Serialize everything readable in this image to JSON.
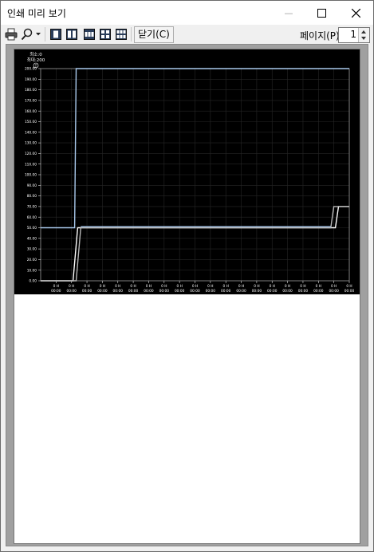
{
  "window": {
    "title": "인쇄 미리 보기",
    "min_glyph": "—",
    "max_glyph": "☐",
    "close_glyph": "✕"
  },
  "toolbar": {
    "close_label": "닫기(C)",
    "page_label": "페이지(P)",
    "page_value": "1"
  },
  "chart_data": {
    "type": "line",
    "header_min": "최소:0",
    "header_max": "최대:200",
    "unit_marker": "T",
    "ylim": [
      0,
      200
    ],
    "y_ticks": [
      "0.00",
      "10.00",
      "20.00",
      "30.00",
      "40.00",
      "50.00",
      "60.00",
      "70.00",
      "80.00",
      "90.00",
      "100.00",
      "110.00",
      "120.00",
      "130.00",
      "140.00",
      "150.00",
      "160.00",
      "170.00",
      "180.00",
      "190.00",
      "200.00"
    ],
    "x_ticks": [
      [
        "0 H",
        "00:00"
      ],
      [
        "0 H",
        "00:00"
      ],
      [
        "0 H",
        "00:00"
      ],
      [
        "0 H",
        "00:00"
      ],
      [
        "0 H",
        "00:00"
      ],
      [
        "0 H",
        "00:00"
      ],
      [
        "0 H",
        "00:00"
      ],
      [
        "0 H",
        "00:00"
      ],
      [
        "0 H",
        "00:00"
      ],
      [
        "0 H",
        "00:00"
      ],
      [
        "0 H",
        "00:00"
      ],
      [
        "0 H",
        "00:00"
      ],
      [
        "0 H",
        "00:00"
      ],
      [
        "0 H",
        "00:00"
      ],
      [
        "0 H",
        "00:00"
      ],
      [
        "0 H",
        "00:00"
      ],
      [
        "0 H",
        "00:00"
      ],
      [
        "0 H",
        "00:00"
      ],
      [
        "0 H",
        "00:00"
      ],
      [
        "0 H",
        "00:00"
      ]
    ],
    "grid": true,
    "series": [
      {
        "color": "#a9c9ec",
        "x": [
          0,
          0.11,
          0.115,
          1
        ],
        "y": [
          50,
          50,
          200,
          200
        ]
      },
      {
        "color": "#ffffff",
        "x": [
          0,
          0.105,
          0.12,
          0.955,
          0.965,
          1
        ],
        "y": [
          0,
          0,
          50,
          50,
          70,
          70
        ]
      },
      {
        "color": "#b8b8b8",
        "x": [
          0,
          0.115,
          0.13,
          0.94,
          0.95,
          1
        ],
        "y": [
          0,
          0,
          50,
          50,
          70,
          70
        ]
      },
      {
        "color": "#a9c9ec",
        "x": [
          0.13,
          0.94
        ],
        "y": [
          51,
          51
        ]
      }
    ]
  }
}
